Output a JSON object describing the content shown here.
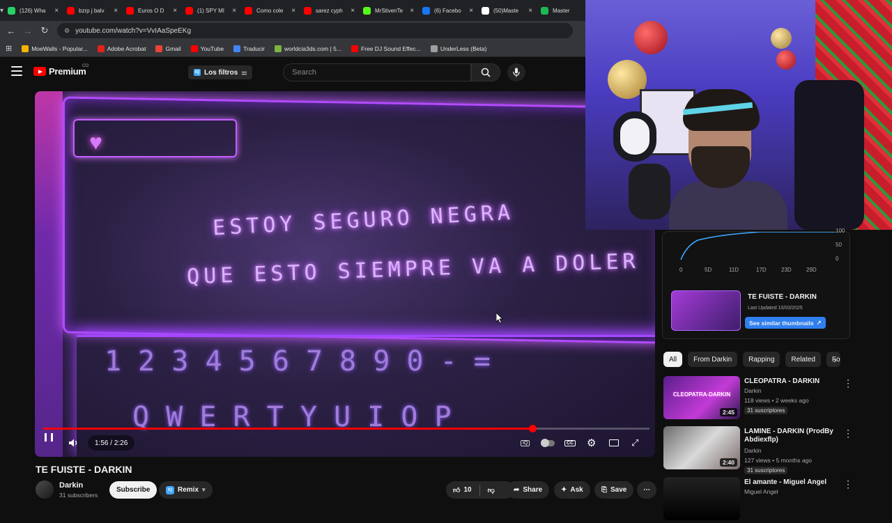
{
  "browser": {
    "tabs": [
      {
        "label": "(126) Wha",
        "color": "#25d366"
      },
      {
        "label": "bzrp j balv",
        "color": "#ff0000"
      },
      {
        "label": "Euros O D",
        "color": "#ff0000"
      },
      {
        "label": "(1) SPY MI",
        "color": "#ff0000"
      },
      {
        "label": "Como cole",
        "color": "#ff0000"
      },
      {
        "label": "sarez cyph",
        "color": "#ff0000"
      },
      {
        "label": "MrStivenTe",
        "color": "#53fc18"
      },
      {
        "label": "(6) Facebo",
        "color": "#1877f2"
      },
      {
        "label": "(50)Maste",
        "color": "#ffffff"
      },
      {
        "label": "Master",
        "color": "#1db954"
      }
    ],
    "url": "youtube.com/watch?v=VvIAaSpeEKg",
    "bookmarks": [
      {
        "label": "MoeWalls - Popular...",
        "color": "#f4b400"
      },
      {
        "label": "Adobe Acrobat",
        "color": "#e2231a"
      },
      {
        "label": "Gmail",
        "color": "#ea4335"
      },
      {
        "label": "YouTube",
        "color": "#ff0000"
      },
      {
        "label": "Traducir",
        "color": "#4285f4"
      },
      {
        "label": "worldcia3ds.com | 5...",
        "color": "#7cb342"
      },
      {
        "label": "Free DJ Sound Effec...",
        "color": "#ff0000"
      },
      {
        "label": "UnderLess (Beta)",
        "color": "#9e9e9e"
      }
    ]
  },
  "youtube": {
    "logo_word": "Premium",
    "country": "CO",
    "filters_label": "Los filtros",
    "search_placeholder": "Search"
  },
  "video": {
    "lyric_line_1": "ESTOY SEGURO NEGRA",
    "lyric_line_2": "QUE ESTO SIEMPRE VA A DOLER",
    "keyboard_row_1": "1 2 3 4 5 6 7 8 9 0 - =",
    "keyboard_row_2": "Q W E R T Y U I O P",
    "time": "1:56 / 2:26",
    "progress_fraction": 0.807,
    "title": "TE FUISTE - DARKIN",
    "channel": "Darkin",
    "subscribers": "31 subscribers",
    "subscribe_label": "Subscribe",
    "remix_label": "Remix",
    "likes": "10",
    "share_label": "Share",
    "ask_label": "Ask",
    "save_label": "Save"
  },
  "stats": {
    "x_ticks": [
      "0",
      "5D",
      "11D",
      "17D",
      "23D",
      "29D"
    ],
    "y_ticks": [
      "100",
      "50",
      "0"
    ],
    "title": "TE FUISTE - DARKIN",
    "updated": "Last Updated 10/03/2025",
    "similar_label": "See similar thumbnails",
    "line_color": "#3ea6ff"
  },
  "chips": [
    "All",
    "From Darkin",
    "Rapping",
    "Related",
    "Fo"
  ],
  "recommendations": [
    {
      "title": "CLEOPATRA - DARKIN",
      "channel": "Darkin",
      "meta": "118 views • 2 weeks ago",
      "subs": "31 suscriptores",
      "duration": "2:45",
      "thumb_text": "CLEOPATRA-DARKIN"
    },
    {
      "title": "LAMINE - DARKIN (ProdBy Abdiexflp)",
      "channel": "Darkin",
      "meta": "127 views • 5 months ago",
      "subs": "31 suscriptores",
      "duration": "2:40",
      "thumb_text": ""
    },
    {
      "title": "El amante - Miguel Angel",
      "channel": "Miguel Angel",
      "meta": "",
      "subs": "",
      "duration": "",
      "thumb_text": ""
    }
  ]
}
